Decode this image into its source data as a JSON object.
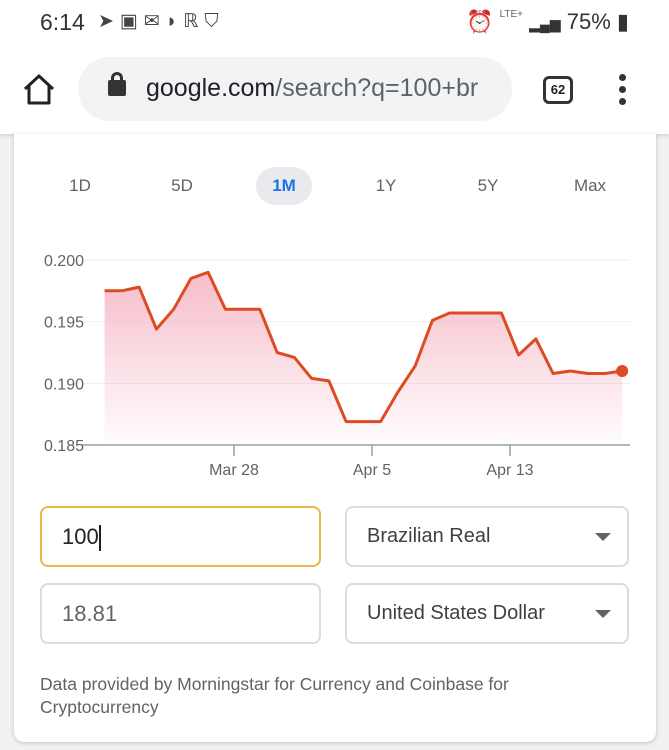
{
  "status_bar": {
    "time": "6:14",
    "notification_icons": [
      "telegram-icon",
      "google-translate-icon",
      "gmail-icon",
      "app-icon",
      "reddit-icon",
      "brave-icon"
    ],
    "alarm_icon": "alarm-icon",
    "network": "LTE+",
    "battery": "75%"
  },
  "browser": {
    "url_host": "google.com",
    "url_path": "/search?q=100+br",
    "tab_count": "62"
  },
  "ranges": [
    {
      "label": "1D"
    },
    {
      "label": "5D"
    },
    {
      "label": "1M",
      "active": true
    },
    {
      "label": "1Y"
    },
    {
      "label": "5Y"
    },
    {
      "label": "Max"
    }
  ],
  "chart_data": {
    "type": "area",
    "x": [
      "Mar 20",
      "Mar 21",
      "Mar 22",
      "Mar 23",
      "Mar 24",
      "Mar 25",
      "Mar 26",
      "Mar 27",
      "Mar 29",
      "Mar 30",
      "Mar 31",
      "Apr 1",
      "Apr 2",
      "Apr 3",
      "Apr 5",
      "Apr 6",
      "Apr 7",
      "Apr 8",
      "Apr 9",
      "Apr 12",
      "Apr 13",
      "Apr 14",
      "Apr 15",
      "Apr 16",
      "Apr 17",
      "Apr 18",
      "Apr 19"
    ],
    "values": [
      0.1975,
      0.1975,
      0.1978,
      0.1944,
      0.196,
      0.1985,
      0.199,
      0.196,
      0.196,
      0.1925,
      0.1921,
      0.1904,
      0.1902,
      0.1869,
      0.1869,
      0.1893,
      0.1914,
      0.1951,
      0.1957,
      0.1957,
      0.1923,
      0.1936,
      0.1908,
      0.191,
      0.1908,
      0.1908,
      0.191
    ],
    "ylim": [
      0.185,
      0.2
    ],
    "yticks": [
      "0.200",
      "0.195",
      "0.190",
      "0.185"
    ],
    "xticks": [
      "Mar 28",
      "Apr 5",
      "Apr 13"
    ],
    "grid": true,
    "line_color": "#dd4b22",
    "fill_color": "#f4a7b9"
  },
  "converter": {
    "amount": "100",
    "from_currency": "Brazilian Real",
    "result": "18.81",
    "to_currency": "United States Dollar"
  },
  "attribution": "Data provided by Morningstar for Currency and Coinbase for Cryptocurrency"
}
